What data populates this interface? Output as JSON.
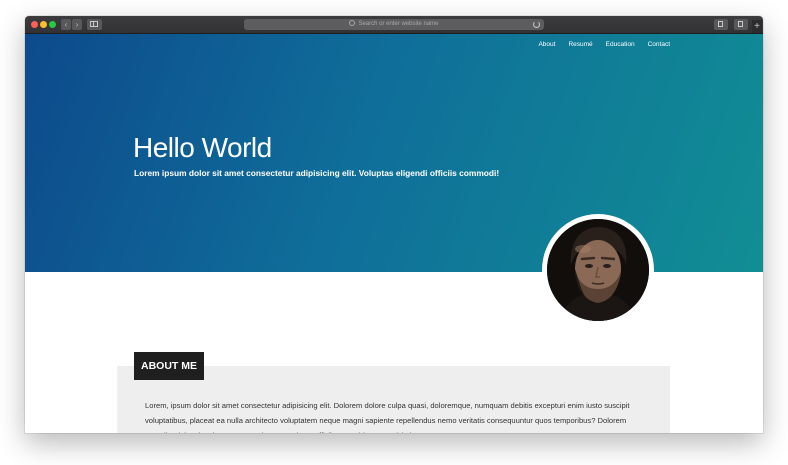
{
  "browser": {
    "url_placeholder": "Search or enter website name",
    "back_glyph": "‹",
    "forward_glyph": "›",
    "new_tab_glyph": "+"
  },
  "nav": {
    "items": [
      {
        "label": "About"
      },
      {
        "label": "Resumé"
      },
      {
        "label": "Education"
      },
      {
        "label": "Contact"
      }
    ]
  },
  "hero": {
    "title": "Hello World",
    "subtitle": "Lorem ipsum dolor sit amet consectetur adipisicing elit. Voluptas eligendi officiis commodi!",
    "gradient_start": "#0d4a8c",
    "gradient_end": "#118e94"
  },
  "profile": {
    "avatar_icon": "portrait-photo"
  },
  "about": {
    "heading": "ABOUT ME",
    "body": "Lorem, ipsum dolor sit amet consectetur adipisicing elit. Dolorem dolore culpa quasi, doloremque, numquam debitis excepturi enim iusto suscipit voluptatibus, placeat ea nulla architecto voluptatem neque magni sapiente repellendus nemo veritatis consequuntur quos temporibus? Dolorem expedita dolor sint vitae. Nemo maiores possimus officiis aut quidem perspiciatis."
  }
}
